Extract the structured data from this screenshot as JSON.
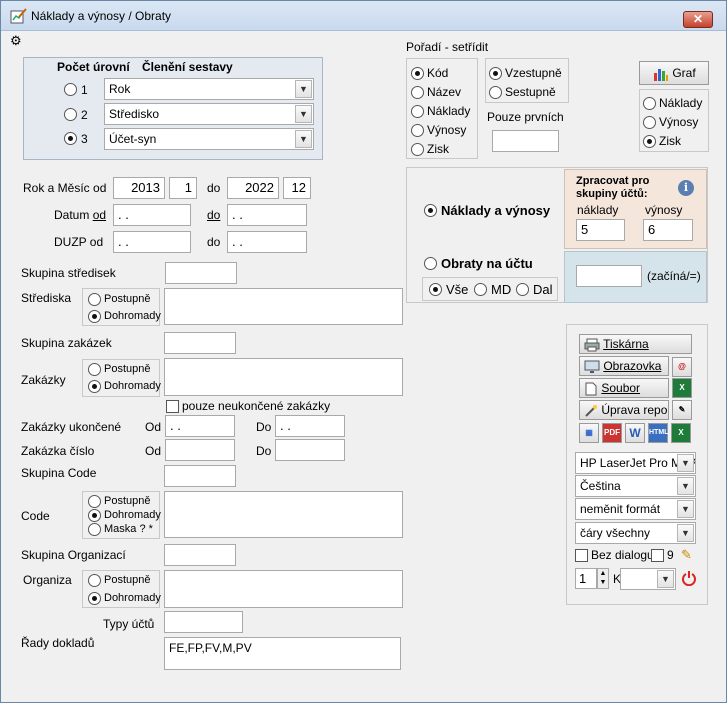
{
  "window": {
    "title": "Náklady a výnosy / Obraty",
    "close": "✕"
  },
  "levels": {
    "header_count": "Počet úrovní",
    "header_struct": "Členění sestavy",
    "options": [
      {
        "label": "1",
        "value": "Rok",
        "selected": false
      },
      {
        "label": "2",
        "value": "Středisko",
        "selected": false
      },
      {
        "label": "3",
        "value": "Účet-syn",
        "selected": true
      }
    ]
  },
  "sort": {
    "title": "Pořadí - setřídit",
    "fields": [
      "Kód",
      "Název",
      "Náklady",
      "Výnosy",
      "Zisk"
    ],
    "selected_field": "Kód",
    "directions": [
      "Vzestupně",
      "Sestupně"
    ],
    "selected_direction": "Vzestupně",
    "first_only_label": "Pouze prvních",
    "first_only_value": ""
  },
  "graph": {
    "button": "Graf",
    "options": [
      "Náklady",
      "Výnosy",
      "Zisk"
    ],
    "selected": "Zisk"
  },
  "period": {
    "year_month_label": "Rok a Měsíc od",
    "from_year": "2013",
    "from_month": "1",
    "to_label": "do",
    "to_year": "2022",
    "to_month": "12",
    "date_label_pre": "Datum ",
    "date_label_ul": "od",
    "date_to_ul": "do",
    "date_from": " . .",
    "date_to": " . .",
    "duzp_label": "DUZP od",
    "duzp_to_label": "do",
    "duzp_from": " . .",
    "duzp_to": " . ."
  },
  "mode": {
    "costs_revenues": "Náklady a výnosy",
    "turnover": "Obraty na účtu",
    "selected": "Náklady a výnosy",
    "sub_options": [
      "Vše",
      "MD",
      "Dal"
    ],
    "sub_selected": "Vše",
    "process_title": "Zpracovat pro skupiny účtů:",
    "costs_label": "náklady",
    "costs_value": "5",
    "revenues_label": "výnosy",
    "revenues_value": "6",
    "starts_with_label": "(začíná/=)",
    "starts_with_value": ""
  },
  "filters": {
    "centre_group_label": "Skupina středisek",
    "centres_label": "Střediska",
    "order_group_label": "Skupina zakázek",
    "orders_label": "Zakázky",
    "unfinished_orders": "pouze neukončené zakázky",
    "finished_orders_label": "Zakázky ukončené",
    "order_number_label": "Zakázka číslo",
    "od": "Od",
    "do": "Do",
    "finished_from": " . .",
    "finished_to": " . .",
    "code_group_label": "Skupina Code",
    "code_label": "Code",
    "org_group_label": "Skupina Organizací",
    "org_label": "Organiza",
    "account_types_label": "Typy účtů",
    "doc_series_label": "Řady dokladů",
    "doc_series_value": "FE,FP,FV,M,PV",
    "postupne": "Postupně",
    "dohromady": "Dohromady",
    "maska": "Maska ? *"
  },
  "output": {
    "printer_btn": "Tiskárna",
    "screen_btn": "Obrazovka",
    "file_btn": "Soubor",
    "edit_btn": "Úprava repor",
    "printer_select": "HP LaserJet Pro MFP",
    "language_select": "Čeština",
    "format_select": "neměnit formát",
    "lines_select": "čáry všechny",
    "no_dialog": "Bez dialogu",
    "nine": "9",
    "copies": "1",
    "k_label": "K"
  },
  "colors": {
    "process_bg": "#f5e6dc",
    "starts_bg": "#d5e4ea",
    "title_bg": "#c9d9ee"
  }
}
